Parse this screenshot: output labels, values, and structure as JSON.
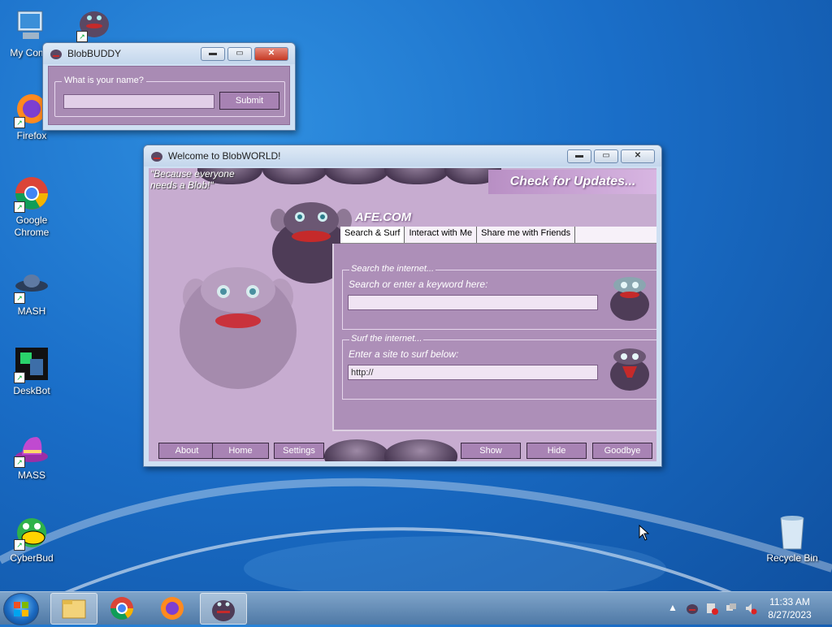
{
  "desktop": {
    "icons": [
      {
        "label": "My Comp"
      },
      {
        "label": "Firefox"
      },
      {
        "label": "Google Chrome"
      },
      {
        "label": "MASH"
      },
      {
        "label": "DeskBot"
      },
      {
        "label": "MASS"
      },
      {
        "label": "CyberBud"
      },
      {
        "label": "Recycle Bin"
      }
    ]
  },
  "buddy_window": {
    "title": "BlobBUDDY",
    "group_label": "What is your name?",
    "name_input_value": "",
    "submit_label": "Submit"
  },
  "world_window": {
    "title": "Welcome to BlobWORLD!",
    "slogan_line1": "\"Because everyone",
    "slogan_line2": "needs a Blob!\"",
    "update_banner": "Check for Updates...",
    "logo_fragment": "AFE.COM",
    "tabs": [
      {
        "label": "Search & Surf"
      },
      {
        "label": "Interact with Me"
      },
      {
        "label": "Share me with Friends"
      }
    ],
    "search_group": {
      "legend": "Search the internet...",
      "hint": "Search or enter a keyword here:",
      "value": ""
    },
    "surf_group": {
      "legend": "Surf the internet...",
      "hint": "Enter a site to surf below:",
      "value": "http://"
    },
    "buttons": {
      "about": "About",
      "home": "Home",
      "settings": "Settings",
      "show": "Show",
      "hide": "Hide",
      "goodbye": "Goodbye"
    }
  },
  "taskbar": {
    "time": "11:33 AM",
    "date": "8/27/2023"
  },
  "colors": {
    "window_purple": "#a98bb4",
    "panel_purple": "#ad8fb8",
    "desktop_blue": "#1a6ec8"
  }
}
